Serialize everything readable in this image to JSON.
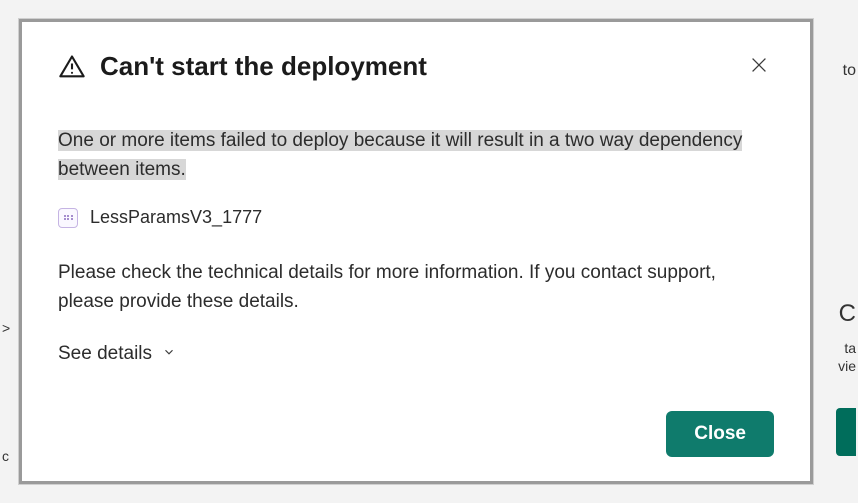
{
  "dialog": {
    "title": "Can't start the deployment",
    "error_message": "One or more items failed to deploy because it will result in a two way dependency between items.",
    "item_name": "LessParamsV3_1777",
    "guidance": "Please check the technical details for more information. If you contact support, please provide these details.",
    "see_details_label": "See details",
    "close_label": "Close"
  },
  "background_fragments": {
    "right1": "to",
    "right2": "C",
    "right3": "ta",
    "right4": "vie",
    "left1": ">",
    "left2": "c"
  }
}
